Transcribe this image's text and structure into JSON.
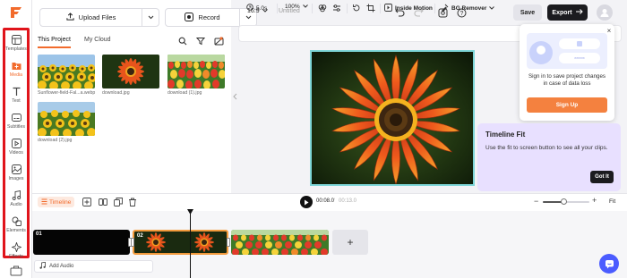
{
  "app": {
    "logo": "filmora-logo",
    "brand_color": "#f26b2c",
    "highlight_color": "#e0141b"
  },
  "sidebar": {
    "items": [
      {
        "label": "Templates",
        "icon": "templates-icon",
        "active": false
      },
      {
        "label": "Media",
        "icon": "media-icon",
        "active": true
      },
      {
        "label": "Text",
        "icon": "text-icon",
        "active": false
      },
      {
        "label": "Subtitles",
        "icon": "subtitles-icon",
        "active": false
      },
      {
        "label": "Videos",
        "icon": "videos-icon",
        "active": false
      },
      {
        "label": "Images",
        "icon": "images-icon",
        "active": false
      },
      {
        "label": "Audio",
        "icon": "audio-icon",
        "active": false
      },
      {
        "label": "Elements",
        "icon": "elements-icon",
        "active": false
      },
      {
        "label": "Effects",
        "icon": "effects-icon",
        "active": false
      }
    ]
  },
  "media_panel": {
    "upload_label": "Upload Files",
    "record_label": "Record",
    "tabs": [
      "This Project",
      "My Cloud"
    ],
    "active_tab": "This Project",
    "files": [
      {
        "name": "Sunflower-field-Fal...a.webp",
        "kind": "sunflowers"
      },
      {
        "name": "download.jpg",
        "kind": "gazania"
      },
      {
        "name": "download (1).jpg",
        "kind": "tulips"
      },
      {
        "name": "download (2).jpg",
        "kind": "sunflowers"
      }
    ]
  },
  "topbar": {
    "aspect_ratio": "16:9",
    "project_title": "Untitled",
    "save_label": "Save",
    "export_label": "Export"
  },
  "canvas_toolbar": {
    "duration": "5.0s",
    "zoom": "100%",
    "inside_motion_label": "Inside Motion",
    "bg_remover_label": "BG Remover"
  },
  "signin_popup": {
    "message": "Sign in to save project changes in case of data loss",
    "button_label": "Sign Up"
  },
  "tooltip": {
    "title": "Timeline Fit",
    "body": "Use the fit to screen button to see all your clips.",
    "button_label": "Got It"
  },
  "timeline": {
    "tab_label": "Timeline",
    "current_time": "00:08.0",
    "separator": "/",
    "total_time": "00:13.0",
    "zoom_level": 0.45,
    "fit_label": "Fit",
    "clips": [
      {
        "number": "01",
        "kind": "black"
      },
      {
        "number": "02",
        "kind": "gazania",
        "selected": true
      },
      {
        "number": "",
        "kind": "tulips"
      }
    ],
    "add_clip_label": "+",
    "add_audio_label": "Add Audio"
  }
}
